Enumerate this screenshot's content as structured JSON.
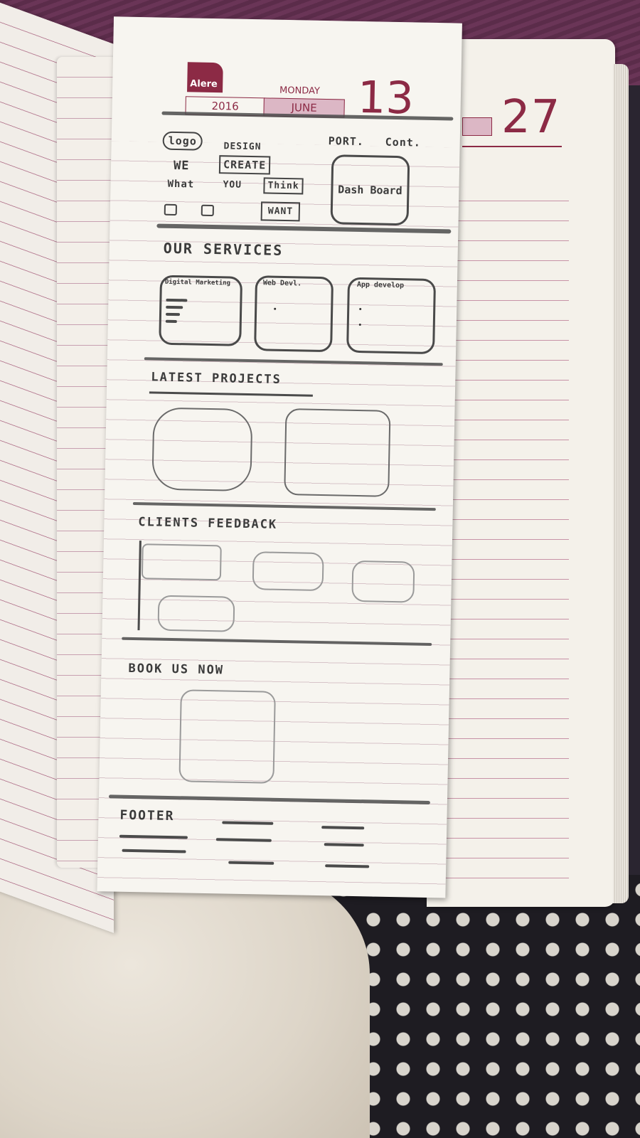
{
  "planner": {
    "brand": "Alere",
    "year": "2016",
    "weekday": "MONDAY",
    "month": "JUNE",
    "day": "13",
    "next_day": "27"
  },
  "sketch": {
    "nav": {
      "logo": "logo",
      "portfolio": "PORT.",
      "contact": "Cont."
    },
    "hero": {
      "line1_prefix": "WE",
      "word_design": "DESIGN",
      "word_create": "CREATE",
      "line2_prefix": "What",
      "line2_you": "YOU",
      "word_think": "Think",
      "word_want": "WANT",
      "dashboard": "Dash Board"
    },
    "services": {
      "heading": "OUR SERVICES",
      "cards": [
        "Digital Marketing",
        "Web Devl.",
        "App develop"
      ]
    },
    "projects": {
      "heading": "LATEST PROJECTS"
    },
    "feedback": {
      "heading": "CLIENTS FEEDBACK"
    },
    "booking": {
      "heading": "BOOK US NOW"
    },
    "footer": {
      "heading": "FOOTER"
    }
  }
}
